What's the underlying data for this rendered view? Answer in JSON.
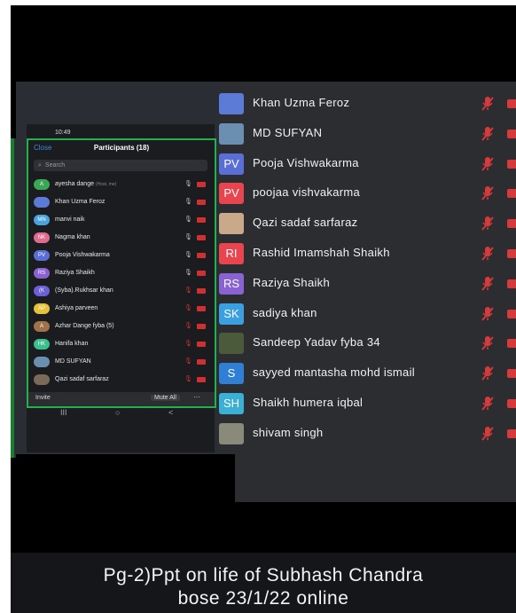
{
  "phone": {
    "time": "10:49",
    "status_right": "▪ ▾ ▮",
    "close": "Close",
    "title": "Participants (18)",
    "search_placeholder": "Search",
    "invite": "Invite",
    "mute_all": "Mute All",
    "more": "···",
    "nav": [
      "III",
      "○",
      "<"
    ],
    "participants": [
      {
        "initials": "A",
        "name": "ayesha dange",
        "tag": "(Host, me)",
        "color": "#3aa757",
        "mic": "on"
      },
      {
        "initials": "",
        "name": "Khan Uzma Feroz",
        "tag": "",
        "color": "#5b7bd6",
        "mic": "on"
      },
      {
        "initials": "MN",
        "name": "manvi naik",
        "tag": "",
        "color": "#4aa3df",
        "mic": "on"
      },
      {
        "initials": "NK",
        "name": "Nagma khan",
        "tag": "",
        "color": "#e06b8f",
        "mic": "on"
      },
      {
        "initials": "PV",
        "name": "Pooja Vishwakarma",
        "tag": "",
        "color": "#5a6fd6",
        "mic": "on"
      },
      {
        "initials": "RS",
        "name": "Raziya Shaikh",
        "tag": "",
        "color": "#8a63d2",
        "mic": "on"
      },
      {
        "initials": "(K",
        "name": "(Syba).Rukhsar khan",
        "tag": "",
        "color": "#6d5fd6",
        "mic": "off"
      },
      {
        "initials": "AP",
        "name": "Ashiya parveen",
        "tag": "",
        "color": "#e6c23a",
        "mic": "off"
      },
      {
        "initials": "A",
        "name": "Azhar Dange fyba (5)",
        "tag": "",
        "color": "#a0724a",
        "mic": "off"
      },
      {
        "initials": "HK",
        "name": "Hanifa khan",
        "tag": "",
        "color": "#3bbf8c",
        "mic": "off"
      },
      {
        "initials": "",
        "name": "MD SUFYAN",
        "tag": "",
        "color": "#6a8fb0",
        "mic": "off"
      },
      {
        "initials": "",
        "name": "Qazi sadaf sarfaraz",
        "tag": "",
        "color": "#7a6a5a",
        "mic": "off"
      },
      {
        "initials": "",
        "name": "Rashid Imamshah Shaikh",
        "tag": "",
        "color": "#d94c4c",
        "mic": "off"
      }
    ]
  },
  "list": [
    {
      "initials": "",
      "name": "Khan Uzma Feroz",
      "color": "#5b7bd6"
    },
    {
      "initials": "",
      "name": "MD SUFYAN",
      "color": "#6a8fb0"
    },
    {
      "initials": "PV",
      "name": "Pooja Vishwakarma",
      "color": "#5a6fd6"
    },
    {
      "initials": "PV",
      "name": "poojaa vishvakarma",
      "color": "#e8454f"
    },
    {
      "initials": "",
      "name": "Qazi sadaf sarfaraz",
      "color": "#c9a98a"
    },
    {
      "initials": "RI",
      "name": "Rashid Imamshah Shaikh",
      "color": "#e8454f"
    },
    {
      "initials": "RS",
      "name": "Raziya Shaikh",
      "color": "#8a63d2"
    },
    {
      "initials": "SK",
      "name": "sadiya khan",
      "color": "#3aa0e0"
    },
    {
      "initials": "",
      "name": "Sandeep Yadav fyba 34",
      "color": "#4a5a3a"
    },
    {
      "initials": "S",
      "name": "sayyed mantasha mohd ismail",
      "color": "#2f7fd6"
    },
    {
      "initials": "SH",
      "name": "Shaikh humera iqbal",
      "color": "#3ab0d6"
    },
    {
      "initials": "",
      "name": "shivam singh",
      "color": "#8a8a7a"
    }
  ],
  "caption": {
    "line1": "Pg-2)Ppt on life of Subhash Chandra",
    "line2": "bose 23/1/22 online"
  }
}
